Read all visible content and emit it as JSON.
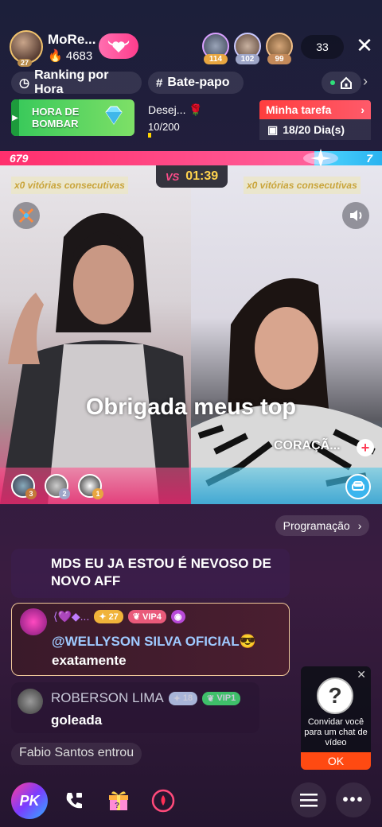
{
  "host": {
    "name": "MoRe...",
    "likes": "4683",
    "level": "27"
  },
  "viewers": [
    {
      "rank": "114",
      "color": "#e8a640"
    },
    {
      "rank": "102",
      "color": "#9ea6c8"
    },
    {
      "rank": "99",
      "color": "#c48a5a"
    }
  ],
  "viewer_count": "33",
  "pills": {
    "ranking": "Ranking por Hora",
    "chat": "Bate-papo"
  },
  "banners": {
    "bombar": "HORA DE BOMBAR",
    "desej_title": "Desej...",
    "desej_value": "10/200",
    "tarefa_title": "Minha tarefa",
    "tarefa_days": "18/20 Dia(s)"
  },
  "pk": {
    "left_score": "679",
    "right_score": "7",
    "vs": "VS",
    "timer": "01:39"
  },
  "streak_text": "x0 vitórias consecutivas",
  "overlay_text": "Obrigada meus top",
  "right_name": "CORAÇÃ...",
  "gifters_left": [
    "3",
    "2",
    "1"
  ],
  "programacao": "Programação",
  "chat": [
    {
      "text": "MDS EU JA ESTOU É NEVOSO DE NOVO AFF"
    },
    {
      "level": "27",
      "vip": "VIP4",
      "mention": "@WELLYSON SILVA OFICIAL😎",
      "text": "exatamente"
    },
    {
      "name": "ROBERSON LIMA",
      "level": "18",
      "vip": "VIP1",
      "text": "goleada"
    }
  ],
  "entrou": "Fabio Santos entrou",
  "invite": {
    "text": "Convidar você para um chat de vídeo",
    "ok": "OK"
  },
  "bottom": {
    "pk": "PK"
  }
}
